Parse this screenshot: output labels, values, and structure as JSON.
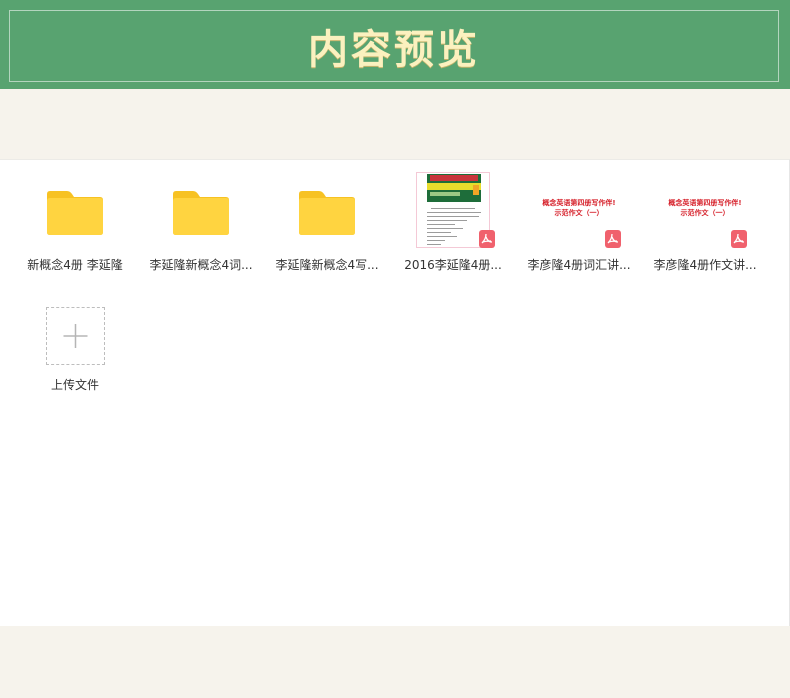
{
  "header": {
    "title": "内容预览"
  },
  "files": [
    {
      "type": "folder",
      "label": "新概念4册 李延隆"
    },
    {
      "type": "folder",
      "label": "李延隆新概念4词..."
    },
    {
      "type": "folder",
      "label": "李延隆新概念4写..."
    },
    {
      "type": "pdf",
      "label": "2016李延隆4册..."
    },
    {
      "type": "pdf",
      "label": "李彦隆4册词汇讲...",
      "preview_line1": "概念英语第四册写作伴!",
      "preview_line2": "示范作文（一）"
    },
    {
      "type": "pdf",
      "label": "李彦隆4册作文讲...",
      "preview_line1": "概念英语第四册写作伴!",
      "preview_line2": "示范作文（一）"
    }
  ],
  "upload": {
    "label": "上传文件"
  },
  "colors": {
    "header_bg": "#58a370",
    "title": "#fbf1bf",
    "folder": "#ffd440",
    "folder_tab": "#f7c223",
    "pdf_badge": "#f0616d",
    "preview_red": "#d6202a"
  }
}
